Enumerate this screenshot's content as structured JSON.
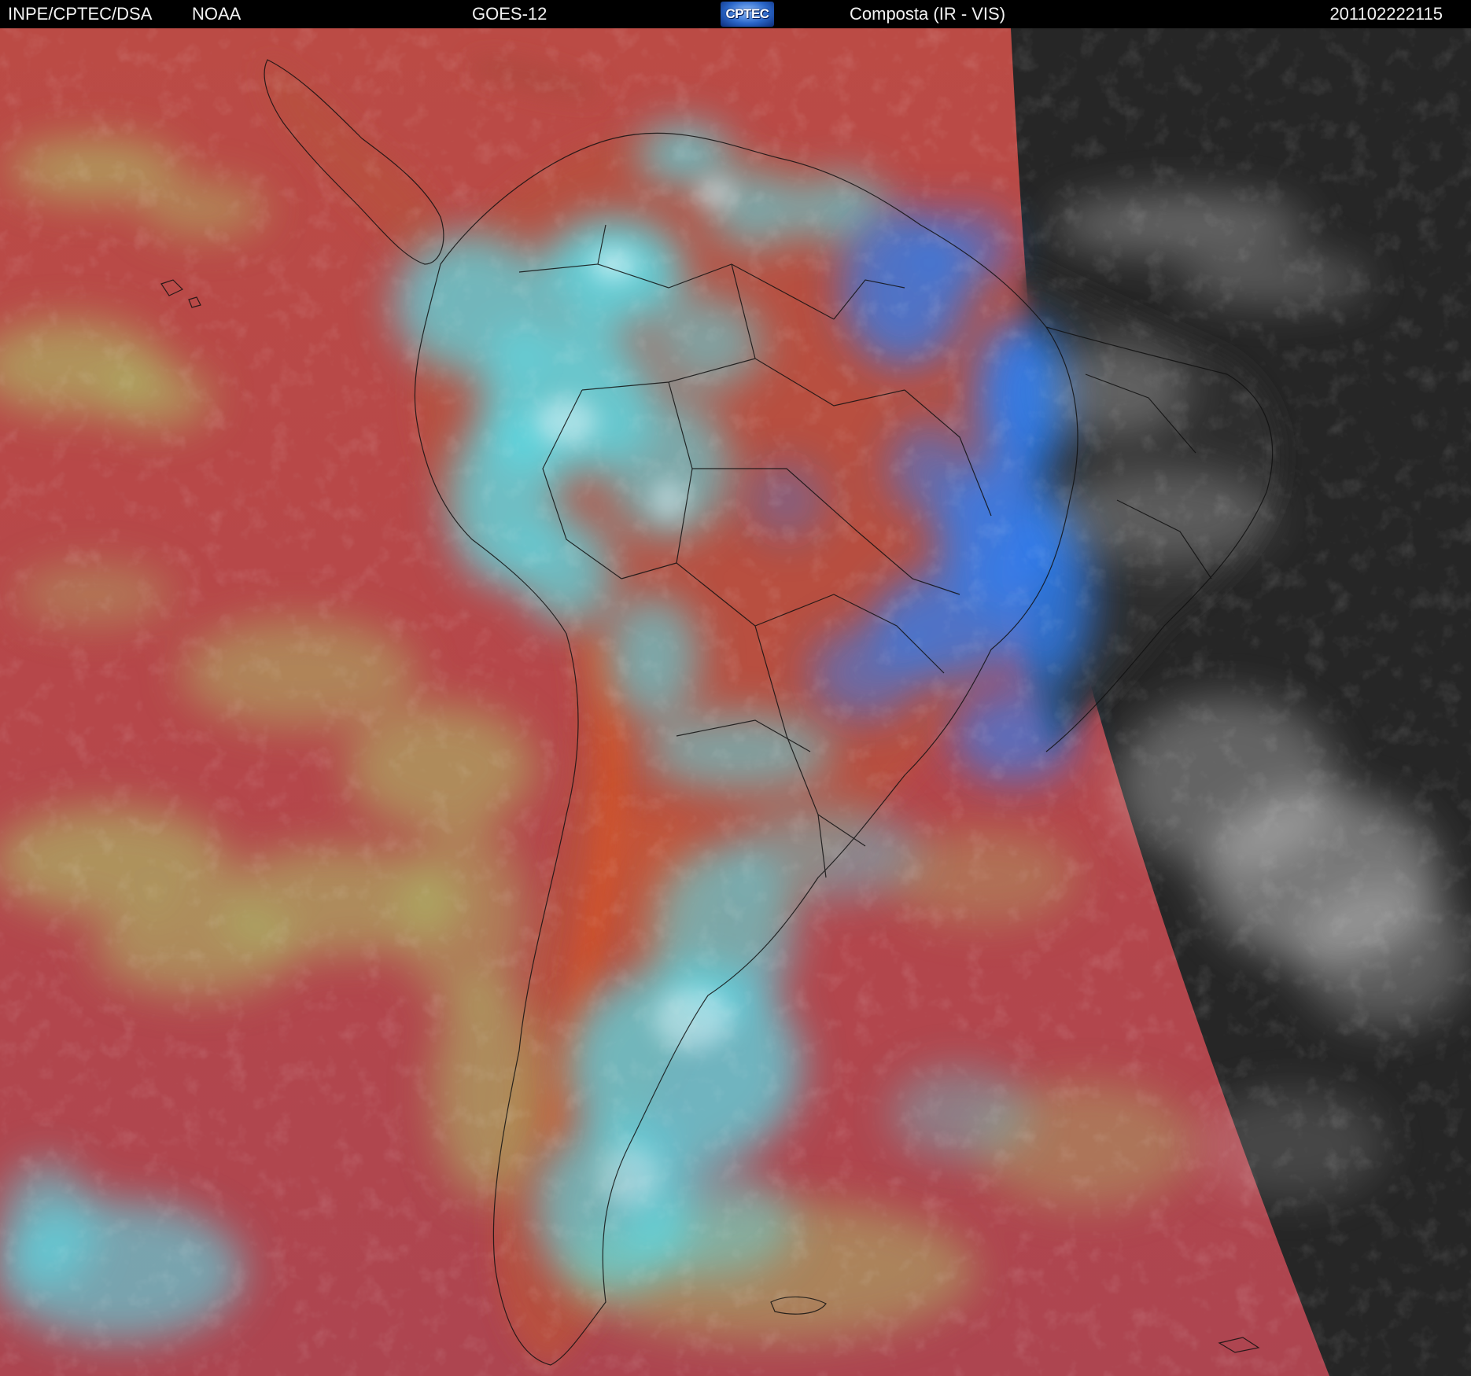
{
  "header": {
    "org": "INPE/CPTEC/DSA",
    "agency": "NOAA",
    "satellite": "GOES-12",
    "logo_text": "CPTEC",
    "product": "Composta (IR - VIS)",
    "timestamp": "201102222115"
  },
  "colors": {
    "header_bg": "#000000",
    "ir_red": "#b84a45",
    "ir_orange": "#d05a34",
    "cloud_cyan": "#4fe3f0",
    "cloud_blue": "#2d7cf0",
    "cloud_yellow_green": "#a6d16a",
    "night_dark": "#262626",
    "night_cloud": "#d6d6d6",
    "border_lines": "#111111"
  },
  "icons": {
    "logo": "cptec-logo"
  }
}
